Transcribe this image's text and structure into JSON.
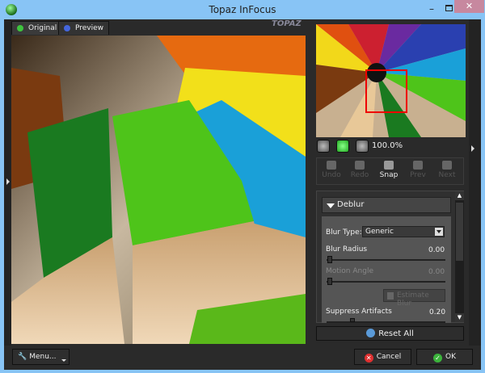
{
  "window": {
    "title": "Topaz InFocus",
    "minimize": "–",
    "close": "✕"
  },
  "tabs": [
    {
      "label": "Original",
      "dot": "#3ec43e"
    },
    {
      "label": "Preview",
      "dot": "#4466dd"
    }
  ],
  "logo": "Topaz",
  "zoom": {
    "value": "100.0%"
  },
  "history": {
    "undo": "Undo",
    "redo": "Redo",
    "snap": "Snap",
    "prev": "Prev",
    "next": "Next"
  },
  "deblur": {
    "header": "Deblur",
    "blur_type_label": "Blur Type:",
    "blur_type_value": "Generic",
    "blur_radius_label": "Blur Radius",
    "blur_radius_value": "0.00",
    "motion_angle_label": "Motion Angle",
    "motion_angle_value": "0.00",
    "estimate_blur": "Estimate Blur",
    "suppress_label": "Suppress Artifacts",
    "suppress_value": "0.20"
  },
  "reset_all": "Reset All",
  "footer": {
    "menu": "Menu...",
    "cancel": "Cancel",
    "ok": "OK"
  }
}
